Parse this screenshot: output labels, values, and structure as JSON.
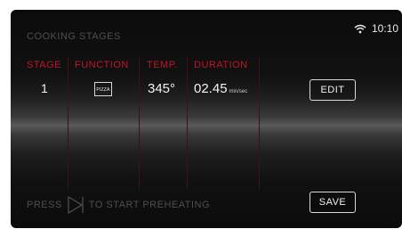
{
  "header": {
    "title": "COOKING STAGES",
    "time": "10:10",
    "wifi_icon": "wifi-icon"
  },
  "table": {
    "columns": [
      "STAGE",
      "FUNCTION",
      "TEMP.",
      "DURATION"
    ],
    "rows": [
      {
        "stage": "1",
        "function_icon": "pizza-icon",
        "function_label": "PIZZA",
        "temp": "345°",
        "duration": "02.45",
        "duration_unit": "min/sec"
      }
    ]
  },
  "buttons": {
    "edit": "EDIT",
    "save": "SAVE"
  },
  "footer": {
    "prefix": "PRESS",
    "play_icon": "play-icon",
    "suffix": "TO START PREHEATING"
  },
  "colors": {
    "accent": "#c0162a",
    "background": "#0b0b0b",
    "text": "#f2f2f2",
    "muted": "#4e4e4e"
  }
}
